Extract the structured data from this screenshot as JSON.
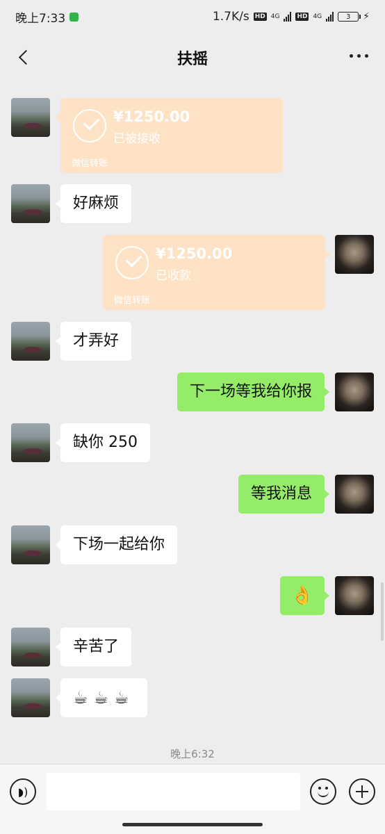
{
  "status_bar": {
    "time": "晚上7:33",
    "speed": "1.7K/s",
    "hd1": "HD",
    "net1": "4G",
    "hd2": "HD",
    "net2": "4G",
    "battery": "3"
  },
  "header": {
    "title": "扶摇"
  },
  "messages": [
    {
      "side": "left",
      "type": "transfer",
      "amount": "¥1250.00",
      "status": "已被接收",
      "label": "微信转账"
    },
    {
      "side": "left",
      "type": "text",
      "text": "好麻烦"
    },
    {
      "side": "right",
      "type": "transfer",
      "amount": "¥1250.00",
      "status": "已收款",
      "label": "微信转账"
    },
    {
      "side": "left",
      "type": "text",
      "text": "才弄好"
    },
    {
      "side": "right",
      "type": "text",
      "text": "下一场等我给你报"
    },
    {
      "side": "left",
      "type": "text",
      "text": "缺你 250"
    },
    {
      "side": "right",
      "type": "text",
      "text": "等我消息"
    },
    {
      "side": "left",
      "type": "text",
      "text": "下场一起给你"
    },
    {
      "side": "right",
      "type": "emoji",
      "text": "👌"
    },
    {
      "side": "left",
      "type": "text",
      "text": "辛苦了"
    },
    {
      "side": "left",
      "type": "emoji",
      "text": "☕☕☕"
    }
  ],
  "time_label": "晚上6:32",
  "input": {
    "value": "",
    "placeholder": ""
  },
  "colors": {
    "background": "#ededed",
    "sent_bubble": "#95ec69",
    "received_bubble": "#ffffff",
    "transfer_bubble": "#fde2c6"
  }
}
